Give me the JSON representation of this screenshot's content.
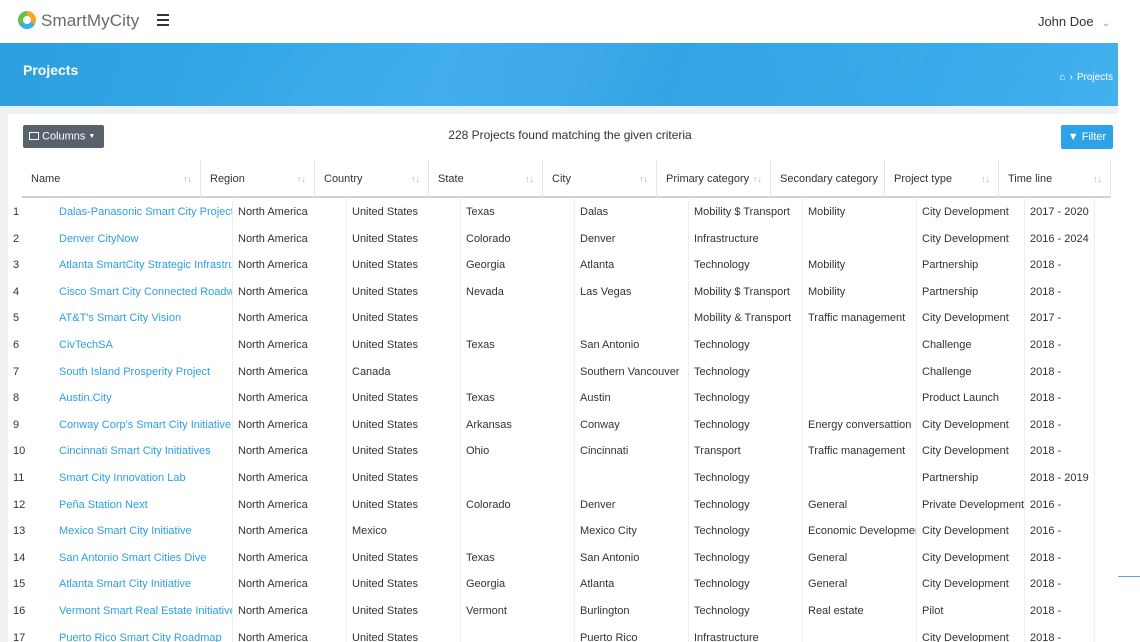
{
  "app": {
    "brand": "SmartMyCity",
    "user_name": "John Doe"
  },
  "banner": {
    "title": "Projects",
    "breadcrumb_current": "Projects"
  },
  "toolbar": {
    "columns_label": "Columns",
    "count_text": "228 Projects found matching the given criteria",
    "filter_label": "Filter"
  },
  "table": {
    "headers": [
      "Name",
      "Region",
      "Country",
      "State",
      "City",
      "Primary category",
      "Secondary category",
      "Project type",
      "Time line"
    ],
    "rows": [
      [
        "1",
        "Dalas-Panasonic Smart City Project",
        "North America",
        "United States",
        "Texas",
        "Dalas",
        "Mobility $ Transport",
        "Mobility",
        "City Development",
        "2017 - 2020"
      ],
      [
        "2",
        "Denver CityNow",
        "North America",
        "United States",
        "Colorado",
        "Denver",
        "Infrastructure",
        "",
        "City Development",
        "2016 - 2024"
      ],
      [
        "3",
        "Atlanta SmartCity Strategic Infrastructure",
        "North America",
        "United States",
        "Georgia",
        "Atlanta",
        "Technology",
        "Mobility",
        "Partnership",
        "2018 -"
      ],
      [
        "4",
        "Cisco Smart City Connected Roadways",
        "North America",
        "United States",
        "Nevada",
        "Las Vegas",
        "Mobility $ Transport",
        "Mobility",
        "Partnership",
        "2018 -"
      ],
      [
        "5",
        "AT&T's Smart City Vision",
        "North America",
        "United States",
        "",
        "",
        "Mobility & Transport",
        "Traffic management",
        "City Development",
        "2017 -"
      ],
      [
        "6",
        "CivTechSA",
        "North America",
        "United States",
        "Texas",
        "San Antonio",
        "Technology",
        "",
        "Challenge",
        "2018 -"
      ],
      [
        "7",
        "South Island Prosperity Project",
        "North America",
        "Canada",
        "",
        "Southern Vancouver",
        "Technology",
        "",
        "Challenge",
        "2018 -"
      ],
      [
        "8",
        "Austin.City",
        "North America",
        "United States",
        "Texas",
        "Austin",
        "Technology",
        "",
        "Product Launch",
        "2018 -"
      ],
      [
        "9",
        "Conway Corp's Smart City Initiative",
        "North America",
        "United States",
        "Arkansas",
        "Conway",
        "Technology",
        "Energy conversattion",
        "City Development",
        "2018 -"
      ],
      [
        "10",
        "Cincinnati Smart City Initiatives",
        "North America",
        "United States",
        "Ohio",
        "Cincinnati",
        "Transport",
        "Traffic management",
        "City Development",
        "2018 -"
      ],
      [
        "11",
        "Smart City Innovation Lab",
        "North America",
        "United States",
        "",
        "",
        "Technology",
        "",
        "Partnership",
        "2018 - 2019"
      ],
      [
        "12",
        "Peña Station Next",
        "North America",
        "United States",
        "Colorado",
        "Denver",
        "Technology",
        "General",
        "Private Development",
        "2016 -"
      ],
      [
        "13",
        "Mexico Smart City Initiative",
        "North America",
        "Mexico",
        "",
        "Mexico City",
        "Technology",
        "Economic Development",
        "City Development",
        "2016 -"
      ],
      [
        "14",
        "San Antonio Smart Cities Dive",
        "North America",
        "United States",
        "Texas",
        "San Antonio",
        "Technology",
        "General",
        "City Development",
        "2018 -"
      ],
      [
        "15",
        "Atlanta Smart City Initiative",
        "North America",
        "United States",
        "Georgia",
        "Atlanta",
        "Technology",
        "General",
        "City Development",
        "2018 -"
      ],
      [
        "16",
        "Vermont Smart Real Estate Initiative",
        "North America",
        "United States",
        "Vermont",
        "Burlington",
        "Technology",
        "Real estate",
        "Pilot",
        "2018 -"
      ],
      [
        "17",
        "Puerto Rico Smart City Roadmap",
        "North America",
        "United States",
        "",
        "Puerto Rico",
        "Infrastructure",
        "",
        "City Development",
        "2018 -"
      ]
    ]
  },
  "colors": {
    "accent": "#2da2e6",
    "link": "#2c9fe0",
    "columns_button": "#58626c"
  }
}
